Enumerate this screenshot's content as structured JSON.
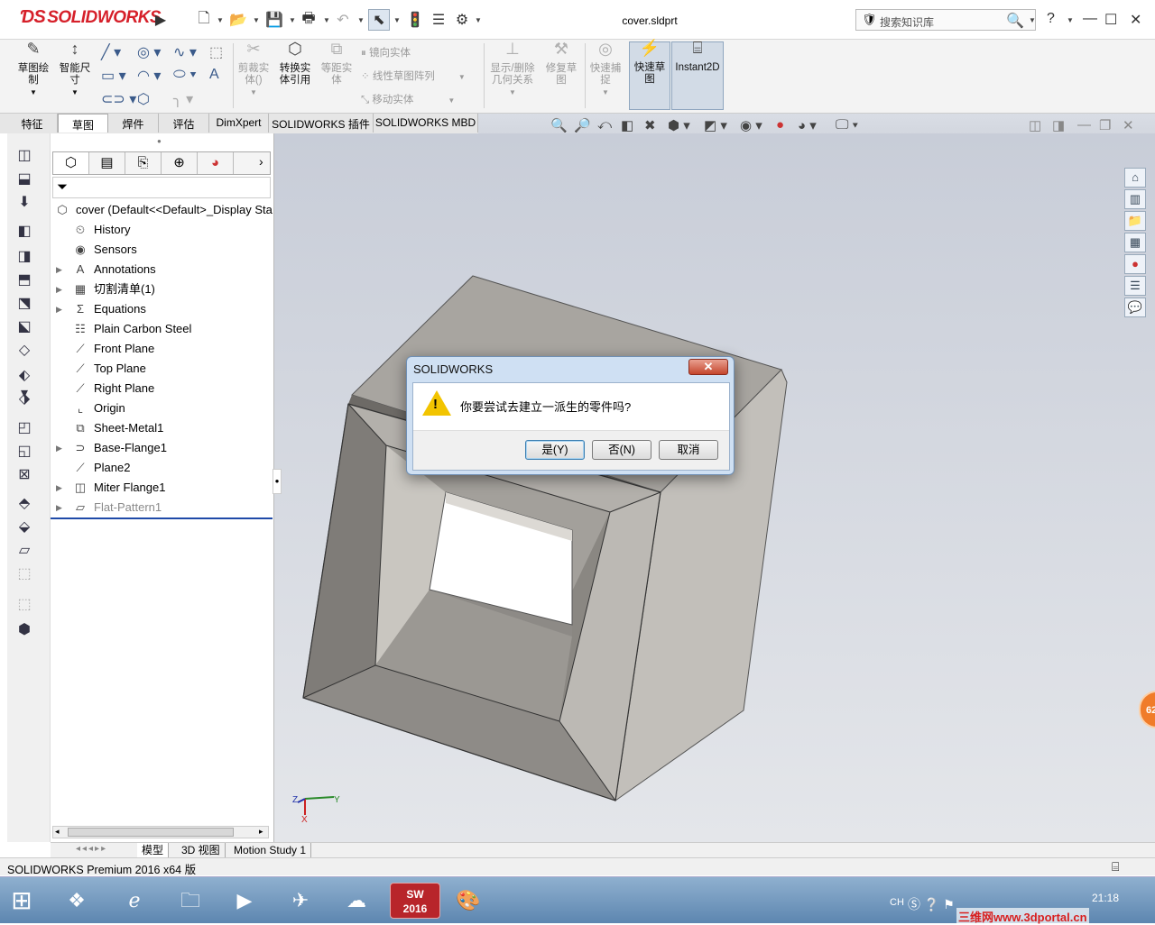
{
  "window": {
    "title": "cover.sldprt",
    "brand": "SOLIDWORKS",
    "search_placeholder": "搜索知识库",
    "help": "?"
  },
  "ribbon": {
    "buttons": [
      {
        "label": "草图绘\n制",
        "enabled": true
      },
      {
        "label": "智能尺\n寸",
        "enabled": true
      },
      {
        "label": "剪裁实\n体()",
        "enabled": false
      },
      {
        "label": "转换实\n体引用",
        "enabled": true
      },
      {
        "label": "等距实\n体",
        "enabled": false
      },
      {
        "label": "显示/删除\n几何关系",
        "enabled": false
      },
      {
        "label": "修复草\n图",
        "enabled": false
      },
      {
        "label": "快速捕\n捉",
        "enabled": false
      },
      {
        "label": "快速草\n图",
        "enabled": true,
        "selected": true
      },
      {
        "label": "Instant2D",
        "enabled": true,
        "selected": true
      }
    ],
    "small_items": [
      "镜向实体",
      "线性草图阵列",
      "移动实体"
    ]
  },
  "tabs": [
    "特征",
    "草图",
    "焊件",
    "评估",
    "DimXpert",
    "SOLIDWORKS 插件",
    "SOLIDWORKS MBD"
  ],
  "active_tab": "草图",
  "feature_tree": {
    "root": "cover  (Default<<Default>_Display Sta",
    "items": [
      {
        "label": "History",
        "icon": "history-icon",
        "expandable": false
      },
      {
        "label": "Sensors",
        "icon": "sensor-icon",
        "expandable": false
      },
      {
        "label": "Annotations",
        "icon": "annotations-icon",
        "expandable": true
      },
      {
        "label": "切割清单(1)",
        "icon": "cutlist-icon",
        "expandable": true
      },
      {
        "label": "Equations",
        "icon": "sigma-icon",
        "expandable": true
      },
      {
        "label": "Plain Carbon Steel",
        "icon": "material-icon",
        "expandable": false
      },
      {
        "label": "Front Plane",
        "icon": "plane-icon",
        "expandable": false
      },
      {
        "label": "Top Plane",
        "icon": "plane-icon",
        "expandable": false
      },
      {
        "label": "Right Plane",
        "icon": "plane-icon",
        "expandable": false
      },
      {
        "label": "Origin",
        "icon": "origin-icon",
        "expandable": false
      },
      {
        "label": "Sheet-Metal1",
        "icon": "sheetmetal-icon",
        "expandable": false
      },
      {
        "label": "Base-Flange1",
        "icon": "baseflange-icon",
        "expandable": true
      },
      {
        "label": "Plane2",
        "icon": "plane-icon",
        "expandable": false
      },
      {
        "label": "Miter Flange1",
        "icon": "miterflange-icon",
        "expandable": true
      },
      {
        "label": "Flat-Pattern1",
        "icon": "flatpattern-icon",
        "expandable": true,
        "suppressed": true
      }
    ]
  },
  "bottom_tabs": [
    "模型",
    "3D 视图",
    "Motion Study 1"
  ],
  "status": "SOLIDWORKS Premium 2016 x64 版",
  "dialog": {
    "title": "SOLIDWORKS",
    "message": "你要尝试去建立一派生的零件吗?",
    "buttons": [
      "是(Y)",
      "否(N)",
      "取消"
    ]
  },
  "taskbar": {
    "lang": "CH",
    "time": "21:18",
    "watermark": "三维网www.3dportal.cn",
    "sw_label": "SW\n2016"
  },
  "triad": {
    "x": "X",
    "y": "Y",
    "z": "Z"
  },
  "badge": "62"
}
